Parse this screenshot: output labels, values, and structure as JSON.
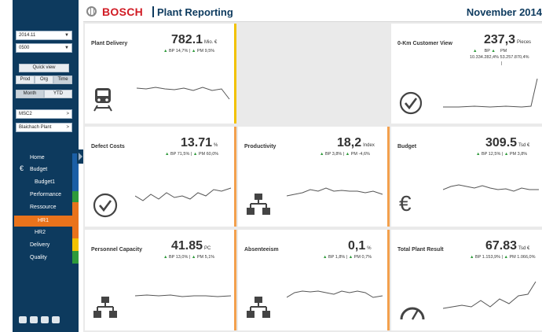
{
  "header": {
    "brand": "BOSCH",
    "app_title": "Plant Reporting",
    "period": "November 2014"
  },
  "sidebar": {
    "date_select": "2014.11",
    "plant_code_select": "0500",
    "quick_view_label": "Quick view",
    "view_buttons": [
      "Prod",
      "Org",
      "Time"
    ],
    "period_buttons": [
      "Month",
      "YTD"
    ],
    "division_link": "MSC2",
    "plant_link": "Blaichach Plant",
    "nav": [
      {
        "label": "Home"
      },
      {
        "label": "Budget"
      },
      {
        "label": "Budget1"
      },
      {
        "label": "Performance"
      },
      {
        "label": "Ressource"
      },
      {
        "label": "HR1"
      },
      {
        "label": "HR2"
      },
      {
        "label": "Delivery"
      },
      {
        "label": "Quality"
      }
    ],
    "strip_colors": {
      "blue": "#1b5fa6",
      "green": "#2e9a3a",
      "orange": "#e9731c",
      "yellow": "#f2c200"
    }
  },
  "colors": {
    "sidebar": "#0d3a5e",
    "brand_red": "#d11b24",
    "accent_orange": "#e9731c",
    "kpi_green": "#2e9a3a"
  },
  "cards": {
    "plant_delivery": {
      "title": "Plant Delivery",
      "value": "782.1",
      "unit": "Mio. €",
      "bp": "BP 14,7% |",
      "pm": "PM 9,5%",
      "icon": "train-icon"
    },
    "zero_km": {
      "title": "0-Km Customer View",
      "value": "237,3",
      "unit": "Pieces",
      "bp": "BP",
      "pm": "PM",
      "detail": "10.334.282,4% 53.257.870,4%",
      "pipe": "|",
      "icon": "check-circle-icon"
    },
    "defect_costs": {
      "title": "Defect Costs",
      "value": "13.71",
      "unit": "%",
      "bp": "BP 71,5% |",
      "pm": "PM 60,0%",
      "icon": "check-circle-icon"
    },
    "productivity": {
      "title": "Productivity",
      "value": "18,2",
      "unit": "Index",
      "bp": "BP 3,8% |",
      "pm": "PM -4,6%",
      "icon": "org-chart-icon"
    },
    "budget": {
      "title": "Budget",
      "value": "309.5",
      "unit": "Tsd €",
      "bp": "BP 12,5% |",
      "pm": "PM 3,8%",
      "icon": "euro-icon"
    },
    "personnel_capacity": {
      "title": "Personnel Capacity",
      "value": "41.85",
      "unit": "PC",
      "bp": "BP 13,0% |",
      "pm": "PM 5,1%",
      "icon": "org-chart-icon"
    },
    "absenteeism": {
      "title": "Absenteeism",
      "value": "0,1",
      "unit": "%",
      "bp": "BP 1,8% |",
      "pm": "PM 0,7%",
      "icon": "org-chart-icon"
    },
    "total_plant_result": {
      "title": "Total Plant Result",
      "value": "67.83",
      "unit": "Tsd €",
      "bp": "BP 1.153,9% |",
      "pm": "PM 1.066,0%",
      "icon": "gauge-icon"
    }
  }
}
